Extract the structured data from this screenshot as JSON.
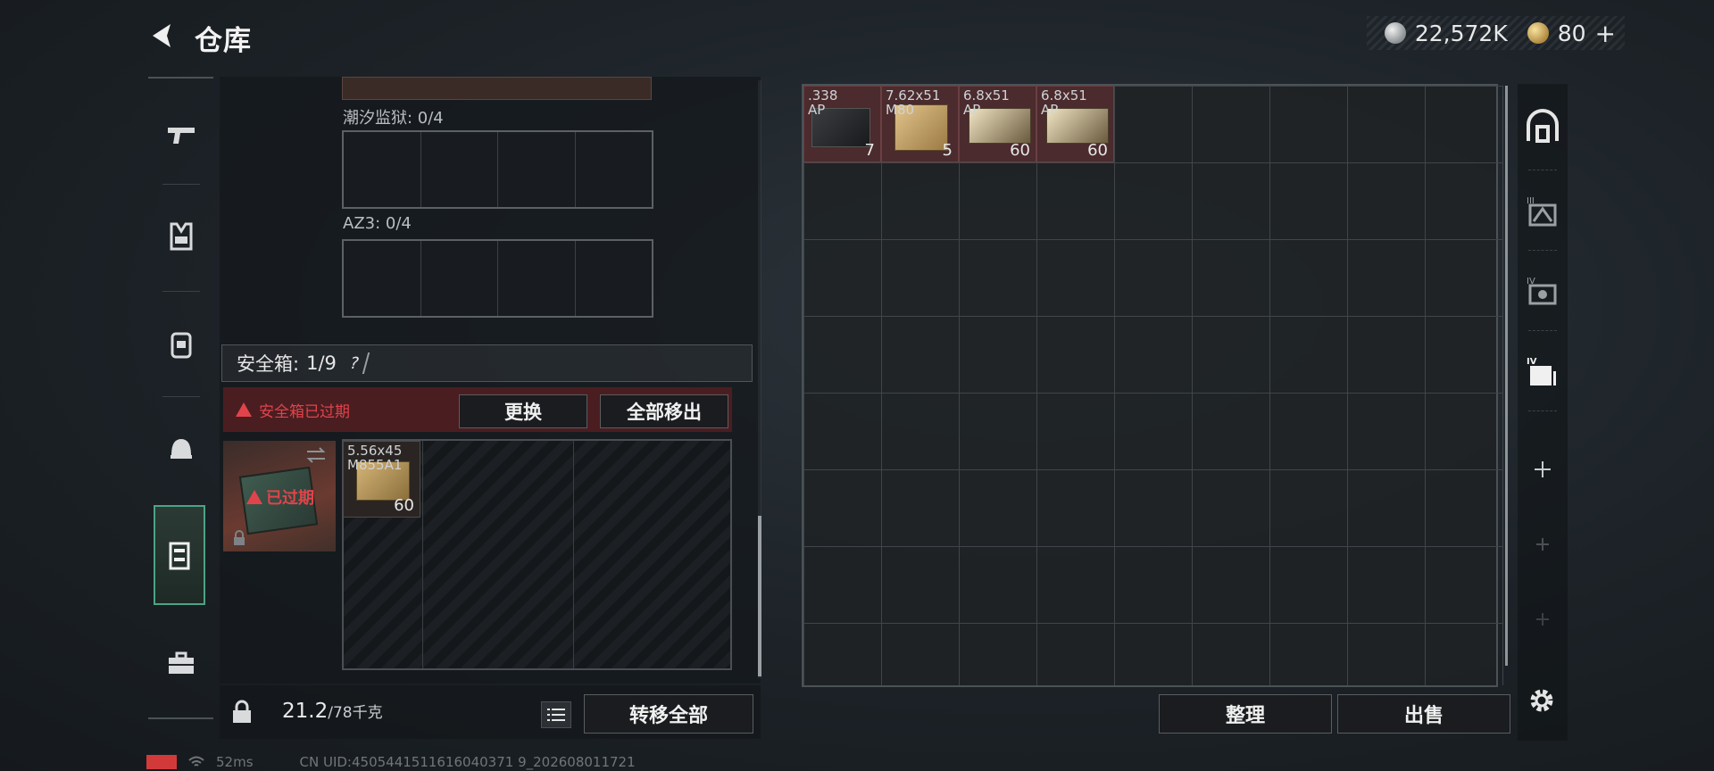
{
  "header": {
    "title": "仓库",
    "silver_value": "22,572K",
    "gold_value": "80",
    "gold_plus": "+"
  },
  "left_nav": [
    "pistol-icon",
    "vest-icon",
    "backpack-icon",
    "helmet-icon",
    "safebox-icon",
    "toolbox-icon"
  ],
  "containers": [
    {
      "label": "潮汐监狱: 0/4"
    },
    {
      "label": "AZ3: 0/4"
    }
  ],
  "safebox": {
    "label": "安全箱:",
    "count": "1/9",
    "help": "?",
    "expired_notice": "安全箱已过期",
    "replace_label": "更换",
    "remove_all_label": "全部移出",
    "expired_badge": "已过期",
    "item": {
      "name": "5.56x45\nM855A1",
      "count": "60"
    }
  },
  "bottom_left": {
    "weight_current": "21.2",
    "weight_max": "/78千克",
    "transfer_all_label": "转移全部"
  },
  "stash": {
    "items": [
      {
        "name": ".338\nAP",
        "count": "7",
        "kind": "338"
      },
      {
        "name": "7.62x51\nM80",
        "count": "5",
        "kind": "762"
      },
      {
        "name": "6.8x51\nAP",
        "count": "60",
        "kind": "68"
      },
      {
        "name": "6.8x51\nAP",
        "count": "60",
        "kind": "68"
      }
    ],
    "tidy_label": "整理",
    "sell_label": "出售"
  },
  "right_nav": [
    "stash-main-icon",
    "stash-3-icon",
    "stash-4-icon",
    "stash-5-icon",
    "add-icon"
  ],
  "footer": {
    "ping": "52ms",
    "uid": "CN UID:4505441511616040371 9_202608011721"
  },
  "colors": {
    "accent": "#4ea383",
    "warning": "#e0444a"
  }
}
